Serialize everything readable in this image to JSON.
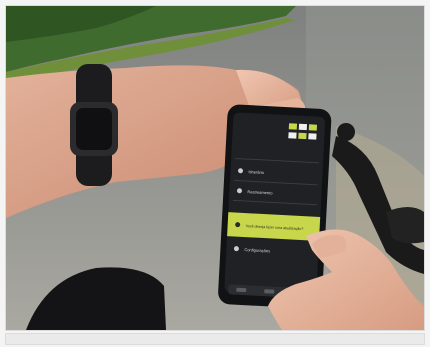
{
  "photo": {
    "alt": "",
    "phone_screen": {
      "menu_items": [
        {
          "label": "Itinerário",
          "icon": "route-icon"
        },
        {
          "label": "Rastreamento",
          "icon": "tracking-icon"
        },
        {
          "label": "Você deseja fazer uma atualização?",
          "icon": "update-icon",
          "highlighted": true
        },
        {
          "label": "Configurações",
          "icon": "settings-icon"
        }
      ]
    }
  },
  "colors": {
    "accent": "#c7d64a",
    "screen_bg": "#1f2125",
    "asphalt": "#8e8f8a"
  }
}
